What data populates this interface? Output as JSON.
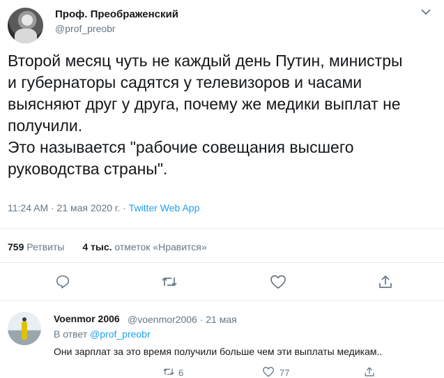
{
  "tweet": {
    "author_name": "Проф. Преображенский",
    "author_handle": "@prof_preobr",
    "text": "Второй месяц чуть не каждый день Путин, министры\nи губернаторы садятся у телевизоров и часами\nвыясняют друг у друга, почему же медики выплат не\nполучили.\nЭто называется \"рабочие совещания высшего\nруководства страны\".",
    "time": "11:24 AM · 21 мая 2020 г. · ",
    "source": "Twitter Web App",
    "retweets_count": "759",
    "retweets_label": "Ретвиты",
    "likes_count": "4 тыс.",
    "likes_label": "отметок «Нравится»",
    "icons": [
      "reply-icon",
      "retweet-icon",
      "like-icon",
      "share-icon",
      "chevron-down-icon"
    ]
  },
  "reply": {
    "author_name": "Voenmor 2006",
    "author_handle": "@voenmor2006 · 21 мая",
    "reply_to_prefix": "В ответ ",
    "reply_to_mention": "@prof_preobr",
    "text": "Они зарплат за это время получили больше чем эти выплаты медикам..",
    "retweets": "6",
    "likes": "77"
  },
  "colors": {
    "accent": "#1da1f2",
    "muted": "#657786",
    "text": "#14171a",
    "divider": "#e6ecf0"
  }
}
